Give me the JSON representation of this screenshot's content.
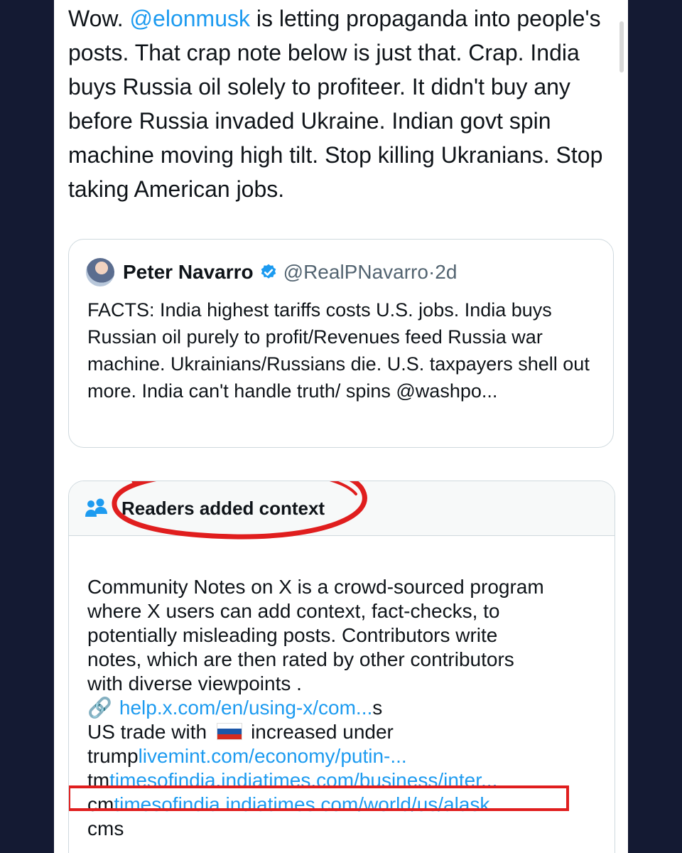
{
  "tweet": {
    "text_before_mention": "Wow.  ",
    "mention": "@elonmusk",
    "text_after_mention": " is letting propaganda into people's posts.  That crap note below is just that.  Crap.  India buys Russia oil solely to profiteer.  It didn't buy any before Russia invaded Ukraine.  Indian govt spin machine moving high tilt.  Stop killing Ukranians.  Stop taking American jobs."
  },
  "quote": {
    "name": "Peter Navarro",
    "handle": "@RealPNavarro",
    "separator": "·",
    "time": "2d",
    "text": "FACTS: India highest tariffs costs U.S. jobs.  India buys Russian oil purely to profit/Revenues feed Russia war machine.  Ukrainians/Russians die.  U.S. taxpayers shell out more.  India can't handle truth/ spins @washpo..."
  },
  "note": {
    "title": "Readers added context",
    "body_lines": [
      "Community Notes on X is a crowd-sourced program",
      "where X users can add context, fact-checks, to",
      "potentially misleading posts. Contributors write",
      "notes, which are then rated by other contributors",
      "with diverse viewpoints ."
    ],
    "link1_icon": "🔗",
    "link1": "help.x.com/en/using-x/com...",
    "link1_suffix": "s",
    "trade_text_before": "US trade with",
    "trade_text_after": "increased under",
    "line_trump_prefix": "trump",
    "link2": "livemint.com/economy/putin-...",
    "line_tm_prefix": "tm",
    "link3": "timesofindia.indiatimes.com/business/inter...",
    "line_cm_prefix": "cm",
    "link4": "timesofindia.indiatimes.com/world/us/alask...",
    "line_last": "cms"
  },
  "colors": {
    "link": "#1d9bf0",
    "annotation_red": "#e01e1e",
    "background_frame": "#141a33"
  },
  "icons": {
    "verified": "verified-badge-icon",
    "people": "people-icon",
    "link": "link-icon",
    "flag": "russia-flag-icon"
  }
}
